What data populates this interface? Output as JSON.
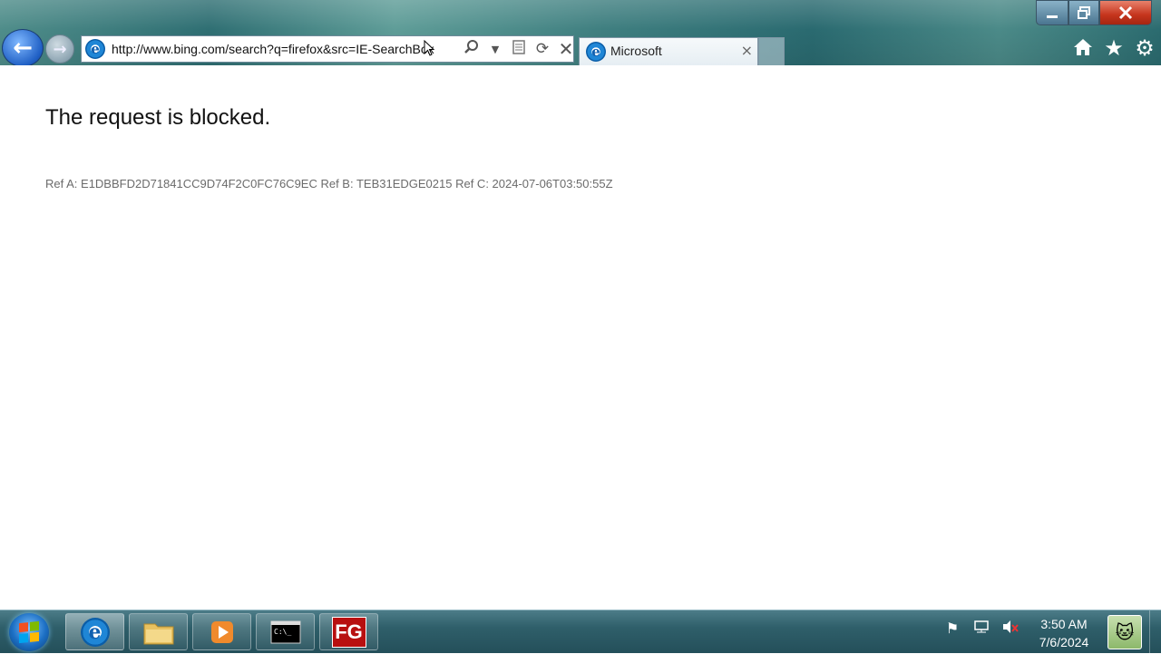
{
  "browser": {
    "address": {
      "url": "http://www.bing.com/search?q=firefox&src=IE-SearchBox",
      "icon": "ie-icon",
      "tools": [
        "search-icon",
        "dropdown-icon",
        "compatibility-icon",
        "refresh-icon",
        "stop-icon"
      ]
    },
    "tab": {
      "title": "Microsoft",
      "close_label": "×"
    },
    "window_controls": [
      "minimize",
      "maximize",
      "close"
    ],
    "right_icons": [
      "home-icon",
      "favorites-icon",
      "tools-gear-icon"
    ]
  },
  "page": {
    "heading": "The request is blocked.",
    "refs": "Ref A: E1DBBFD2D71841CC9D74F2C0FC76C9EC Ref B: TEB31EDGE0215 Ref C: 2024-07-06T03:50:55Z"
  },
  "taskbar": {
    "items": [
      "internet-explorer",
      "windows-explorer",
      "media-player",
      "command-prompt",
      "fg-app"
    ],
    "active_item": "internet-explorer",
    "fg_label": "FG",
    "tray_icons": [
      "action-center-flag-icon",
      "network-icon",
      "volume-muted-icon"
    ],
    "clock": {
      "time": "3:50 AM",
      "date": "7/6/2024"
    }
  },
  "colors": {
    "chrome_teal": "#2f6f73",
    "close_red": "#c5341c",
    "ref_text": "#6b6b6b"
  }
}
